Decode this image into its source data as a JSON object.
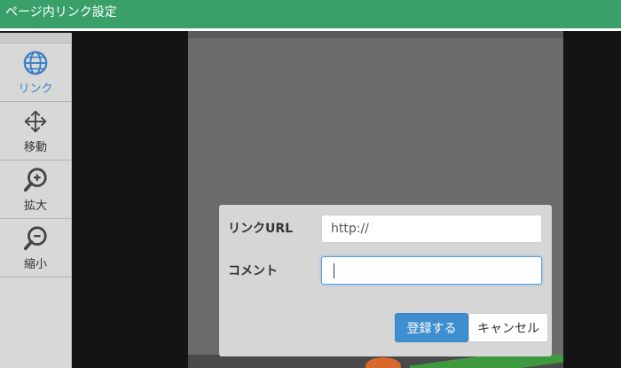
{
  "window": {
    "title": "ページ内リンク設定"
  },
  "sidebar": {
    "tools": [
      {
        "label": "リンク",
        "icon": "globe-icon",
        "active": true
      },
      {
        "label": "移動",
        "icon": "move-arrows-icon",
        "active": false
      },
      {
        "label": "拡大",
        "icon": "zoom-in-icon",
        "active": false
      },
      {
        "label": "縮小",
        "icon": "zoom-out-icon",
        "active": false
      }
    ]
  },
  "dialog": {
    "url_label": "リンクURL",
    "url_value": "http://",
    "comment_label": "コメント",
    "comment_value": "",
    "submit_label": "登録する",
    "cancel_label": "キャンセル"
  },
  "colors": {
    "titlebar": "#3aa06a",
    "accent": "#3f8fd0",
    "active_tool": "#3a7fc9"
  }
}
